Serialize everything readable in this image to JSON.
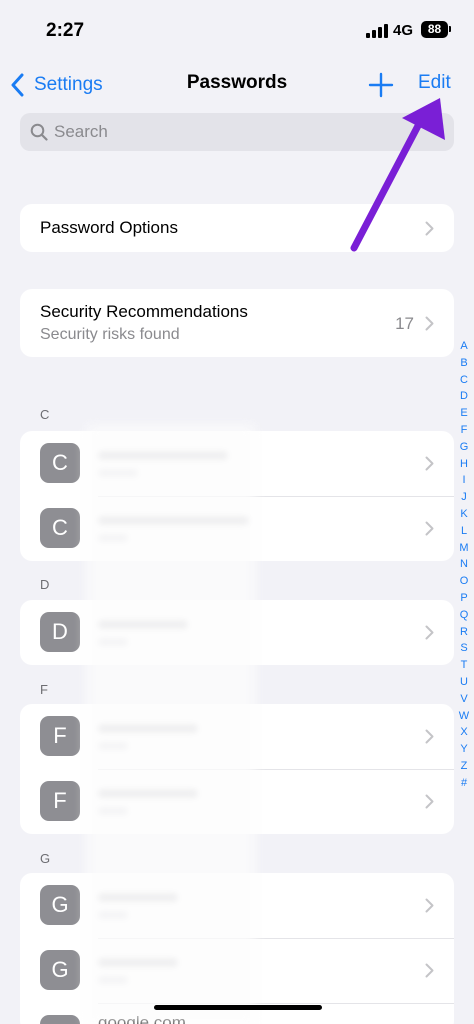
{
  "status": {
    "time": "2:27",
    "network": "4G",
    "battery": "88"
  },
  "nav": {
    "back_label": "Settings",
    "title": "Passwords",
    "edit_label": "Edit"
  },
  "search": {
    "placeholder": "Search"
  },
  "password_options": {
    "label": "Password Options"
  },
  "security": {
    "title": "Security Recommendations",
    "subtitle": "Security risks found",
    "count": "17"
  },
  "sections": [
    {
      "letter": "C",
      "items": [
        {
          "initial": "C"
        },
        {
          "initial": "C"
        }
      ]
    },
    {
      "letter": "D",
      "items": [
        {
          "initial": "D"
        }
      ]
    },
    {
      "letter": "F",
      "items": [
        {
          "initial": "F"
        },
        {
          "initial": "F"
        }
      ]
    },
    {
      "letter": "G",
      "items": [
        {
          "initial": "G"
        },
        {
          "initial": "G"
        }
      ]
    }
  ],
  "partial_item": {
    "title": "google.com"
  },
  "index_letters": [
    "A",
    "B",
    "C",
    "D",
    "E",
    "F",
    "G",
    "H",
    "I",
    "J",
    "K",
    "L",
    "M",
    "N",
    "O",
    "P",
    "Q",
    "R",
    "S",
    "T",
    "U",
    "V",
    "W",
    "X",
    "Y",
    "Z",
    "#"
  ],
  "colors": {
    "accent": "#1a7cf3",
    "annotation_arrow": "#7a1fd6"
  }
}
